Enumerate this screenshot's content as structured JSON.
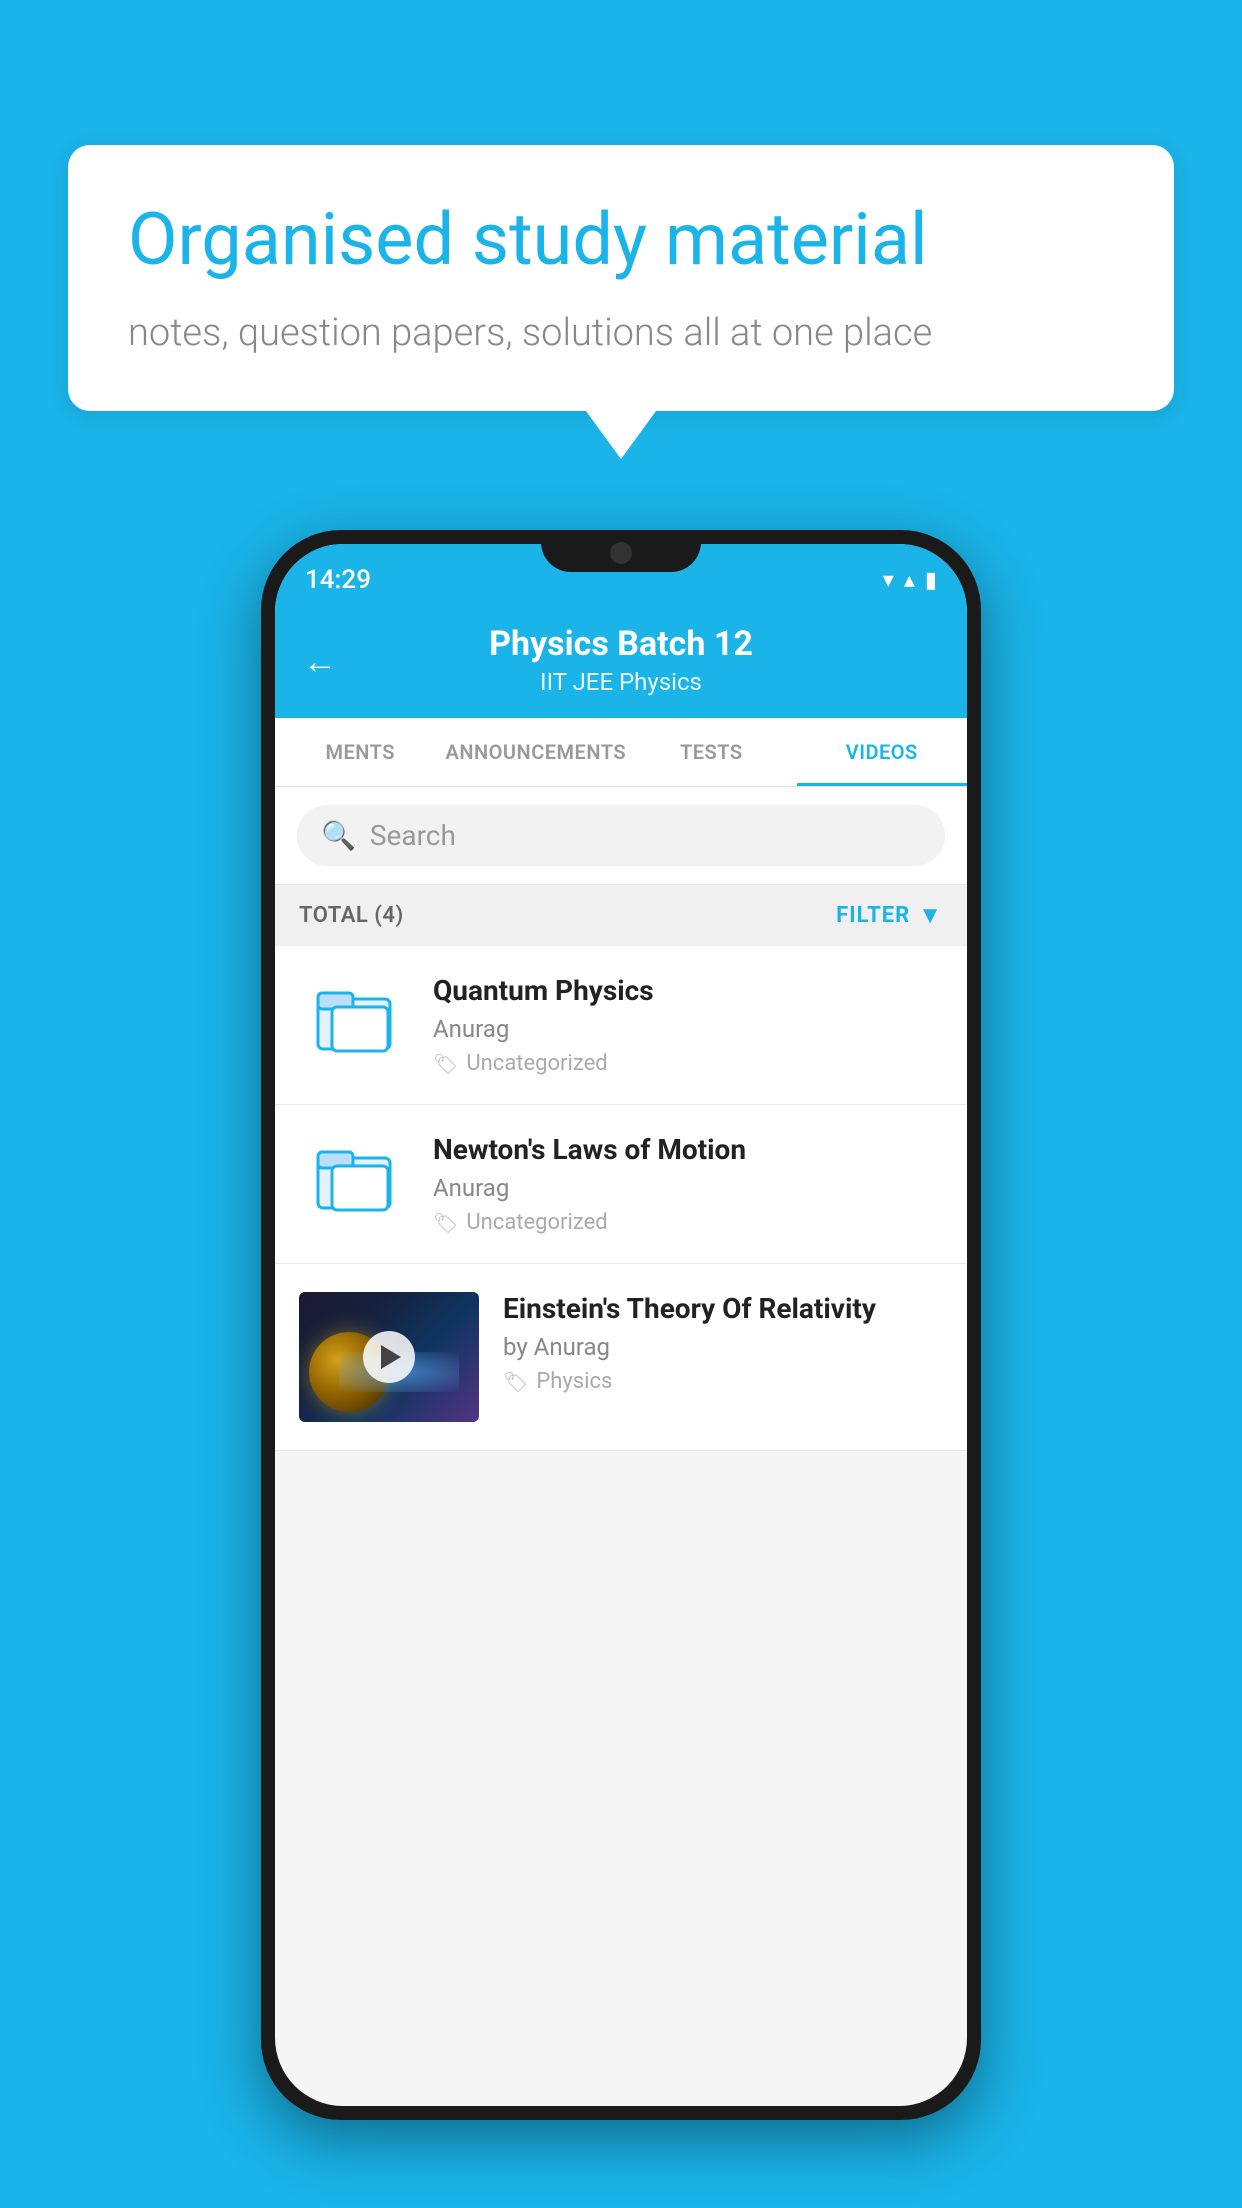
{
  "app": {
    "background_color": "#1ab4e8"
  },
  "hero": {
    "title": "Organised study material",
    "subtitle": "notes, question papers, solutions all at one place"
  },
  "phone": {
    "status_bar": {
      "time": "14:29",
      "wifi_icon": "▼",
      "signal_icon": "▲",
      "battery_icon": "▮"
    },
    "header": {
      "back_label": "←",
      "title": "Physics Batch 12",
      "subtitle_tags": "IIT JEE   Physics"
    },
    "tabs": [
      {
        "label": "MENTS",
        "active": false
      },
      {
        "label": "ANNOUNCEMENTS",
        "active": false
      },
      {
        "label": "TESTS",
        "active": false
      },
      {
        "label": "VIDEOS",
        "active": true
      }
    ],
    "search": {
      "placeholder": "Search"
    },
    "filter_row": {
      "total_label": "TOTAL (4)",
      "filter_label": "FILTER"
    },
    "video_items": [
      {
        "id": 1,
        "title": "Quantum Physics",
        "author": "Anurag",
        "tag": "Uncategorized",
        "type": "folder"
      },
      {
        "id": 2,
        "title": "Newton's Laws of Motion",
        "author": "Anurag",
        "tag": "Uncategorized",
        "type": "folder"
      },
      {
        "id": 3,
        "title": "Einstein's Theory Of Relativity",
        "author": "by Anurag",
        "tag": "Physics",
        "type": "video"
      }
    ]
  }
}
